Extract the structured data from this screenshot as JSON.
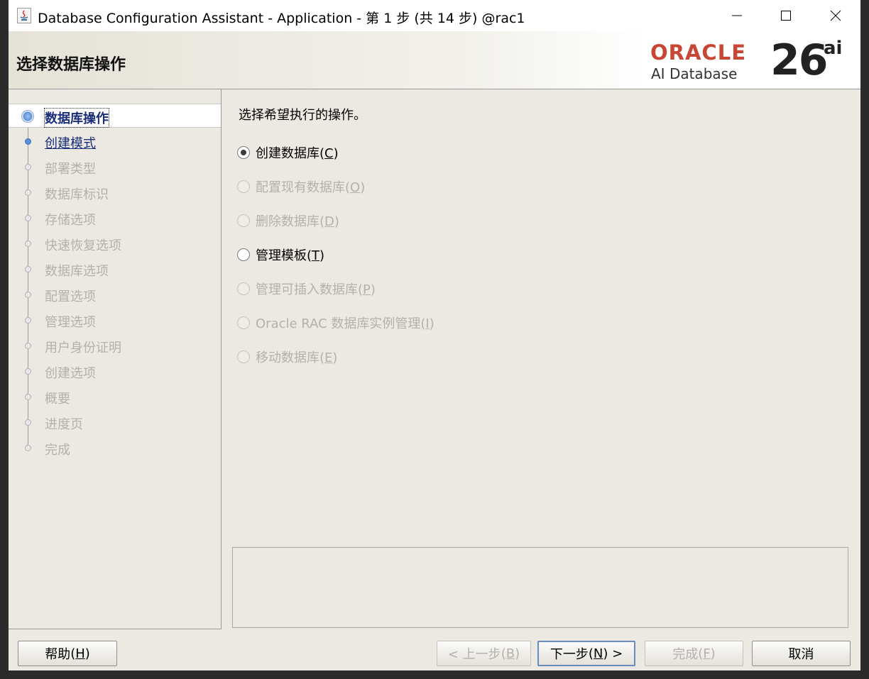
{
  "window": {
    "title": "Database Configuration Assistant - Application - 第 1 步 (共 14 步) @rac1"
  },
  "header": {
    "title": "选择数据库操作",
    "logo_brand": "ORACLE",
    "logo_product": "AI Database",
    "logo_version": "26",
    "logo_version_suffix": "ai"
  },
  "nav": {
    "items": [
      {
        "label": "数据库操作",
        "state": "active"
      },
      {
        "label": "创建模式",
        "state": "next"
      },
      {
        "label": "部署类型",
        "state": "disabled"
      },
      {
        "label": "数据库标识",
        "state": "disabled"
      },
      {
        "label": "存储选项",
        "state": "disabled"
      },
      {
        "label": "快速恢复选项",
        "state": "disabled"
      },
      {
        "label": "数据库选项",
        "state": "disabled"
      },
      {
        "label": "配置选项",
        "state": "disabled"
      },
      {
        "label": "管理选项",
        "state": "disabled"
      },
      {
        "label": "用户身份证明",
        "state": "disabled"
      },
      {
        "label": "创建选项",
        "state": "disabled"
      },
      {
        "label": "概要",
        "state": "disabled"
      },
      {
        "label": "进度页",
        "state": "disabled"
      },
      {
        "label": "完成",
        "state": "disabled"
      }
    ]
  },
  "main": {
    "prompt": "选择希望执行的操作。",
    "options": [
      {
        "label": "创建数据库",
        "mnemonic": "C",
        "checked": true,
        "enabled": true
      },
      {
        "label": "配置现有数据库",
        "mnemonic": "O",
        "checked": false,
        "enabled": false
      },
      {
        "label": "删除数据库",
        "mnemonic": "D",
        "checked": false,
        "enabled": false
      },
      {
        "label": "管理模板",
        "mnemonic": "T",
        "checked": false,
        "enabled": true
      },
      {
        "label": "管理可插入数据库",
        "mnemonic": "P",
        "checked": false,
        "enabled": false
      },
      {
        "label": "Oracle RAC 数据库实例管理",
        "mnemonic": "I",
        "checked": false,
        "enabled": false
      },
      {
        "label": "移动数据库",
        "mnemonic": "E",
        "checked": false,
        "enabled": false
      }
    ]
  },
  "footer": {
    "help": {
      "label": "帮助",
      "mnemonic": "H"
    },
    "back": {
      "label": "< 上一步",
      "mnemonic": "B"
    },
    "next": {
      "label": "下一步",
      "mnemonic": "N",
      "suffix": " >"
    },
    "finish": {
      "label": "完成",
      "mnemonic": "F"
    },
    "cancel": {
      "label": "取消"
    }
  }
}
